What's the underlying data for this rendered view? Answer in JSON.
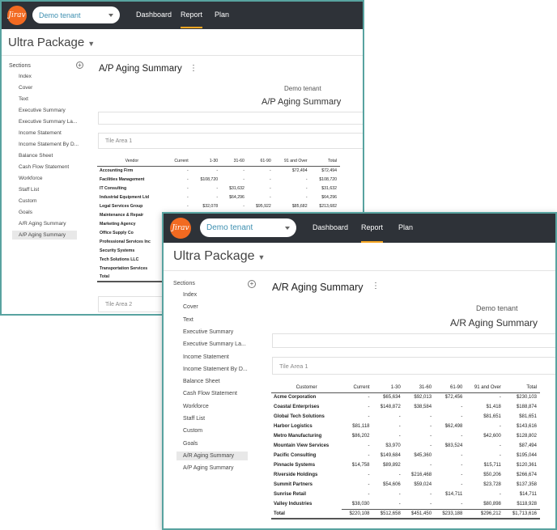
{
  "colors": {
    "teal_border": "#58a3a0",
    "topbar": "#2e3238",
    "logo": "#f26a21",
    "accent": "#f5a623"
  },
  "logo_text": "Jirav",
  "icons": {
    "add": "plus-circle-icon",
    "menu": "kebab-icon",
    "dropdown": "chevron-down-icon"
  },
  "back": {
    "tenant": "Demo tenant",
    "nav": [
      "Dashboard",
      "Report",
      "Plan"
    ],
    "page_title": "Ultra Package",
    "sections_label": "Sections",
    "sidebar": [
      "Index",
      "Cover",
      "Text",
      "Executive Summary",
      "Executive Summary La...",
      "Income Statement",
      "Income Statement By D...",
      "Balance Sheet",
      "Cash Flow Statement",
      "Workforce",
      "Staff List",
      "Custom",
      "Goals",
      "A/R Aging Summary",
      "A/P Aging Summary"
    ],
    "report_title": "A/P Aging Summary",
    "report_tenant": "Demo tenant",
    "report_subtitle": "A/P Aging Summary",
    "tile1": "Tile Area 1",
    "tile2": "Tile Area 2",
    "columns": [
      "Vendor",
      "Current",
      "1-30",
      "31-60",
      "61-90",
      "91 and Over",
      "Total"
    ],
    "rows": [
      [
        "Accounting Firm",
        "-",
        "-",
        "-",
        "-",
        "$72,494",
        "$72,494"
      ],
      [
        "Facilities Management",
        "-",
        "$108,720",
        "-",
        "-",
        "-",
        "$108,720"
      ],
      [
        "IT Consulting",
        "-",
        "-",
        "$31,632",
        "-",
        "-",
        "$31,632"
      ],
      [
        "Industrial Equipment Ltd",
        "-",
        "-",
        "$64,296",
        "-",
        "-",
        "$64,296"
      ],
      [
        "Legal Services Group",
        "-",
        "$32,078",
        "-",
        "$95,922",
        "$85,682",
        "$213,682"
      ],
      [
        "Maintenance & Repair",
        "",
        "",
        "",
        "",
        "",
        ""
      ],
      [
        "Marketing Agency",
        "",
        "",
        "",
        "",
        "",
        ""
      ],
      [
        "Office Supply Co",
        "",
        "",
        "",
        "",
        "",
        ""
      ],
      [
        "Professional Services Inc",
        "",
        "",
        "",
        "",
        "",
        ""
      ],
      [
        "Security Systems",
        "",
        "",
        "",
        "",
        "",
        ""
      ],
      [
        "Tech Solutions LLC",
        "",
        "",
        "",
        "",
        "",
        ""
      ],
      [
        "Transportation Services",
        "",
        "",
        "",
        "",
        "",
        ""
      ]
    ],
    "total_label": "Total"
  },
  "front": {
    "tenant": "Demo tenant",
    "nav": [
      "Dashboard",
      "Report",
      "Plan"
    ],
    "page_title": "Ultra Package",
    "sections_label": "Sections",
    "sidebar": [
      "Index",
      "Cover",
      "Text",
      "Executive Summary",
      "Executive Summary La...",
      "Income Statement",
      "Income Statement By D...",
      "Balance Sheet",
      "Cash Flow Statement",
      "Workforce",
      "Staff List",
      "Custom",
      "Goals",
      "A/R Aging Summary",
      "A/P Aging Summary"
    ],
    "report_title": "A/R Aging Summary",
    "report_tenant": "Demo tenant",
    "report_subtitle": "A/R Aging Summary",
    "tile1": "Tile Area 1",
    "columns": [
      "Customer",
      "Current",
      "1-30",
      "31-60",
      "61-90",
      "91 and Over",
      "Total"
    ],
    "rows": [
      [
        "Acme Corporation",
        "-",
        "$65,634",
        "$92,013",
        "$72,456",
        "-",
        "$230,103"
      ],
      [
        "Coastal Enterprises",
        "-",
        "$148,872",
        "$38,584",
        "-",
        "$1,418",
        "$188,874"
      ],
      [
        "Global Tech Solutions",
        "-",
        "-",
        "-",
        "-",
        "$81,651",
        "$81,651"
      ],
      [
        "Harbor Logistics",
        "$81,118",
        "-",
        "-",
        "$62,498",
        "-",
        "$143,616"
      ],
      [
        "Metro Manufacturing",
        "$86,202",
        "-",
        "-",
        "-",
        "$42,600",
        "$128,802"
      ],
      [
        "Mountain View Services",
        "-",
        "$3,970",
        "-",
        "$83,524",
        "-",
        "$87,494"
      ],
      [
        "Pacific Consulting",
        "-",
        "$149,684",
        "$45,360",
        "-",
        "-",
        "$195,044"
      ],
      [
        "Pinnacle Systems",
        "$14,758",
        "$89,892",
        "-",
        "-",
        "$15,711",
        "$120,361"
      ],
      [
        "Riverside Holdings",
        "-",
        "-",
        "$216,468",
        "-",
        "$50,206",
        "$266,674"
      ],
      [
        "Summit Partners",
        "-",
        "$54,606",
        "$59,024",
        "-",
        "$23,728",
        "$137,358"
      ],
      [
        "Sunrise Retail",
        "-",
        "-",
        "-",
        "$14,711",
        "-",
        "$14,711"
      ],
      [
        "Valley Industries",
        "$38,030",
        "-",
        "-",
        "-",
        "$80,898",
        "$118,928"
      ]
    ],
    "total_label": "Total",
    "totals": [
      "$220,108",
      "$512,658",
      "$451,450",
      "$233,188",
      "$296,212",
      "$1,713,616"
    ]
  }
}
